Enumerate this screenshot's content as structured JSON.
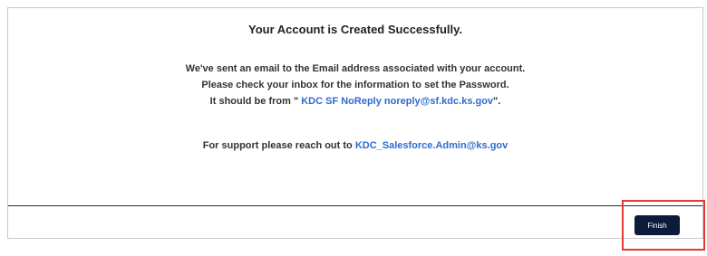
{
  "card": {
    "title": "Your Account is Created Successfully.",
    "message": {
      "line1": "We've sent an email to the Email address associated with your account.",
      "line2": "Please check your inbox for the information to set the Password.",
      "line3_prefix": "It should be from \" ",
      "sender": "KDC SF NoReply noreply@sf.kdc.ks.gov",
      "line3_suffix": "\"."
    },
    "support": {
      "prefix": "For support please reach out to ",
      "email": "KDC_Salesforce.Admin@ks.gov"
    }
  },
  "footer": {
    "finish_label": "Finish"
  },
  "colors": {
    "link": "#2e6bd1",
    "button": "#0b1b3a",
    "highlight": "#e53935"
  }
}
